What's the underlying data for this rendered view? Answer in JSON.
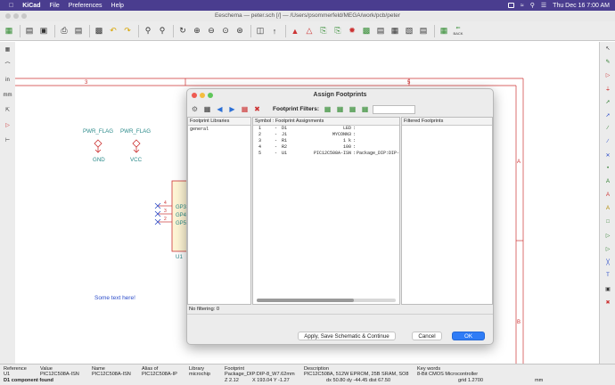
{
  "menubar": {
    "app": "KiCad",
    "items": [
      "File",
      "Preferences",
      "Help"
    ],
    "clock": "Thu Dec 16  7:00 AM"
  },
  "window": {
    "title": "Eeschema — peter.sch [/] — /Users/psommerfeld/MEGA/work/pcb/peter"
  },
  "toolbar": {
    "back_label": "BACK"
  },
  "left_toolbar": {
    "inch_label": "in",
    "mm_label": "mm"
  },
  "schematic": {
    "column_labels": [
      "3",
      "4",
      "5"
    ],
    "row_labels": [
      "A",
      "B"
    ],
    "pwr_flag_1": "PWR_FLAG",
    "pwr_flag_2": "PWR_FLAG",
    "gnd_label": "GND",
    "vcc_label": "VCC",
    "pins": [
      "GP3",
      "GP4",
      "GP5"
    ],
    "pin_numbers": [
      "4",
      "3",
      "2"
    ],
    "ref": "U1",
    "note": "Some text here!"
  },
  "dialog": {
    "title": "Assign Footprints",
    "filters_label": "Footprint Filters:",
    "libraries_header": "Footprint Libraries",
    "libraries": [
      "general"
    ],
    "assignments_header": "Symbol : Footprint Assignments",
    "assignments": [
      {
        "num": "1",
        "ref": "D1",
        "value": "LED",
        "footprint": ""
      },
      {
        "num": "2",
        "ref": "J1",
        "value": "MYCONN3",
        "footprint": ""
      },
      {
        "num": "3",
        "ref": "R1",
        "value": "1 k",
        "footprint": ""
      },
      {
        "num": "4",
        "ref": "R2",
        "value": "100",
        "footprint": ""
      },
      {
        "num": "5",
        "ref": "U1",
        "value": "PIC12C508A-ISN",
        "footprint": "Package_DIP:DIP-8_"
      }
    ],
    "filtered_header": "Filtered Footprints",
    "status": "No filtering: 0",
    "apply_label": "Apply, Save Schematic & Continue",
    "cancel_label": "Cancel",
    "ok_label": "OK"
  },
  "status": {
    "reference_label": "Reference",
    "reference": "U1",
    "value_label": "Value",
    "value": "PIC12C508A-ISN",
    "name_label": "Name",
    "name": "PIC12C508A-ISN",
    "alias_label": "Alias of",
    "alias": "PIC12C508A-IP",
    "library_label": "Library",
    "library": "microchip",
    "footprint_label": "Footprint",
    "footprint": "Package_DIP:DIP-8_W7.62mm",
    "description_label": "Description",
    "description": "PIC12C508A, 512W EPROM, 25B SRAM, SO8",
    "keywords_label": "Key words",
    "keywords": "8-Bit CMOS Microcontroller",
    "found": "D1 component found",
    "zoom": "Z 2.12",
    "xy": "X 193.04  Y -1.27",
    "dxdy": "dx 50.80  dy -44.45  dist 67.50",
    "grid": "grid 1.2700",
    "units": "mm"
  }
}
